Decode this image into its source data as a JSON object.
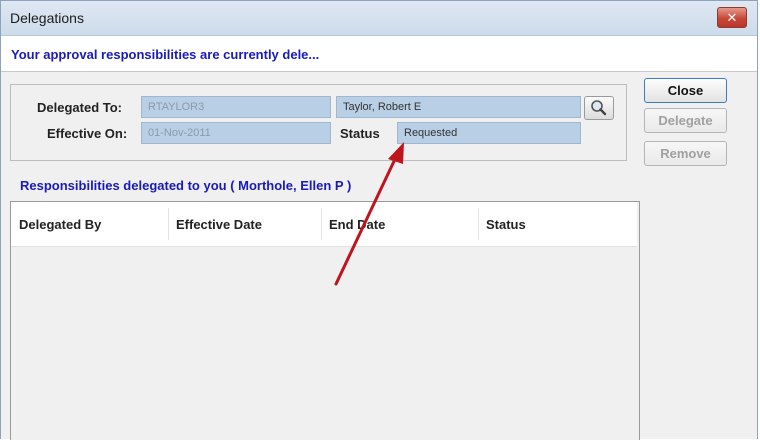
{
  "window": {
    "title": "Delegations",
    "close_glyph": "✕"
  },
  "info": {
    "message": "Your approval responsibilities are currently dele..."
  },
  "form": {
    "delegated_to_label": "Delegated To:",
    "delegated_to_id": "RTAYLOR3",
    "delegated_to_name": "Taylor, Robert E",
    "effective_on_label": "Effective On:",
    "effective_on_value": "01-Nov-2011",
    "status_label": "Status",
    "status_value": "Requested"
  },
  "buttons": {
    "close": "Close",
    "delegate": "Delegate",
    "remove": "Remove"
  },
  "section": {
    "title": "Responsibilities delegated to you ( Morthole, Ellen P )"
  },
  "table": {
    "columns": [
      "Delegated By",
      "Effective Date",
      "End Date",
      "Status"
    ],
    "rows": []
  },
  "colors": {
    "accent_text": "#1a1ab8",
    "field_bg": "#b8cfe6",
    "annotation_arrow": "#c0141c"
  },
  "icons": {
    "search": "magnifier-icon",
    "close": "close-icon"
  }
}
